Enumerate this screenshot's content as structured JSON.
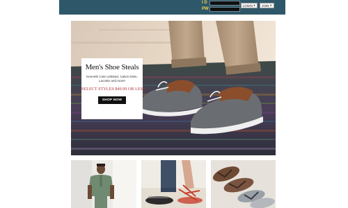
{
  "login": {
    "id_label": "I D",
    "pw_label": "PW",
    "login_label": "LOGIN",
    "join_label": "JOIN"
  },
  "hero": {
    "title": "Men's Shoe Steals",
    "subtitle": "Kenneth Cole Unlisted, Calvin Klein, Lacoste and more!",
    "price_line": "SELECT STYLES $49.99 OR LESS",
    "button": "SHOP NOW"
  },
  "thumbs": [
    {
      "icon": "man-in-green-shirt-photo"
    },
    {
      "icon": "womens-flat-sandals-photo"
    },
    {
      "icon": "flip-flops-photo"
    }
  ],
  "colors": {
    "topbar": "#2e5869",
    "label": "#f0d24a",
    "promo_price": "#b03338"
  }
}
